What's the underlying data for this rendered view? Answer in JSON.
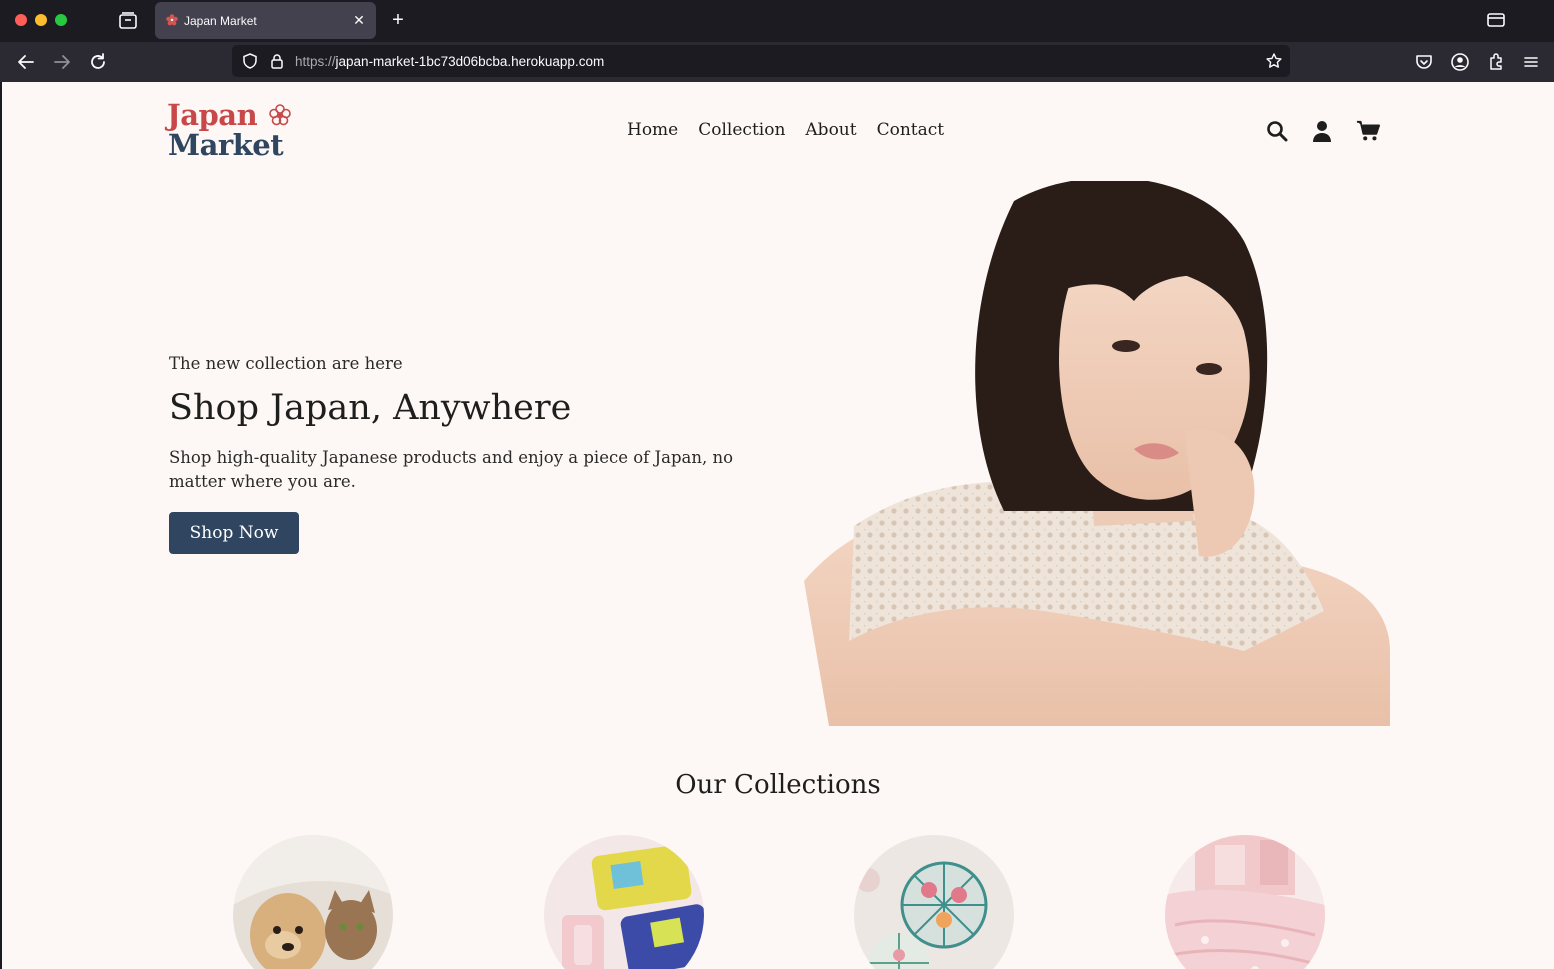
{
  "browser": {
    "tab_title": "Japan Market",
    "url_scheme": "https://",
    "url_host": "japan-market-1bc73d06bcba.herokuapp.com"
  },
  "header": {
    "logo_line1": "Japan",
    "logo_line2": "Market",
    "nav": [
      "Home",
      "Collection",
      "About",
      "Contact"
    ],
    "icons": [
      "search-icon",
      "user-icon",
      "cart-icon"
    ]
  },
  "hero": {
    "eyebrow": "The new collection are here",
    "title": "Shop Japan, Anywhere",
    "description": "Shop high-quality Japanese products and enjoy a piece of Japan, no matter where you are.",
    "cta": "Shop Now"
  },
  "collections": {
    "title": "Our Collections"
  },
  "colors": {
    "brand_red": "#c8484a",
    "brand_navy": "#2f4560",
    "page_bg": "#fdf8f5"
  }
}
